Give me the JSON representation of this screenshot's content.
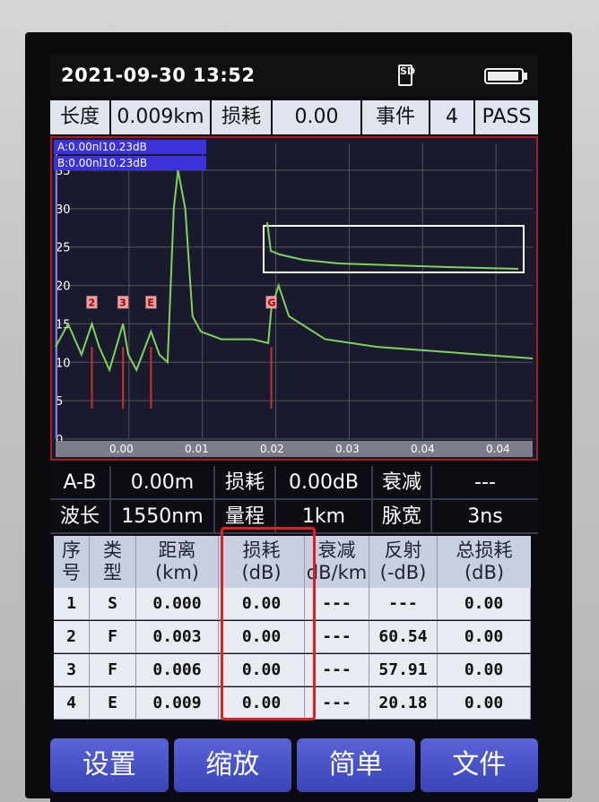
{
  "status": {
    "datetime": "2021-09-30  13:52",
    "sd_icon": "sd-card-icon",
    "battery_icon": "battery-icon",
    "battery_level": 0.95
  },
  "summary": {
    "length_label": "长度",
    "length_value": "0.009km",
    "loss_label": "损耗",
    "loss_value": "0.00",
    "event_label": "事件",
    "event_value": "4",
    "result": "PASS"
  },
  "cursors": {
    "a": "A:0.00nl10.23dB",
    "b": "B:0.00nl10.23dB"
  },
  "chart_data": {
    "type": "line",
    "title": "",
    "xlabel": "",
    "ylabel": "",
    "x_ticks": [
      "0.00",
      "0.01",
      "0.02",
      "0.03",
      "0.04",
      "0.04"
    ],
    "y_ticks": [
      "35",
      "30",
      "25",
      "20",
      "15",
      "10",
      "5",
      "0"
    ],
    "ylim": [
      0,
      35
    ],
    "xlim": [
      -0.001,
      0.045
    ],
    "series_color": "#7fd35a",
    "series": [
      {
        "name": "",
        "x": [
          -0.001,
          0.0002,
          0.0015,
          0.0025,
          0.0032,
          0.0042,
          0.0055,
          0.006,
          0.0068,
          0.0082,
          0.009,
          0.0098,
          0.0104,
          0.0108,
          0.0115,
          0.0122,
          0.013,
          0.015,
          0.018,
          0.0195,
          0.0198,
          0.0205,
          0.0215,
          0.025,
          0.03,
          0.035,
          0.04,
          0.045
        ],
        "y": [
          12,
          15,
          11,
          15,
          12,
          9,
          15,
          11,
          9,
          14,
          11,
          10,
          30,
          35,
          30,
          16,
          14,
          13,
          13,
          12.5,
          17,
          20,
          16,
          13,
          12,
          11.5,
          11,
          10.5
        ]
      }
    ],
    "events": [
      {
        "label": "2",
        "x": 0.0025
      },
      {
        "label": "3",
        "x": 0.0055
      },
      {
        "label": "E",
        "x": 0.0082
      },
      {
        "label": "G",
        "x": 0.0198
      }
    ]
  },
  "ab": {
    "label": "A-B",
    "value": "0.00m",
    "loss_label": "损耗",
    "loss_value": "0.00dB",
    "atten_label": "衰减",
    "atten_value": "---"
  },
  "params": {
    "wave_label": "波长",
    "wave_value": "1550nm",
    "range_label": "量程",
    "range_value": "1km",
    "pulse_label": "脉宽",
    "pulse_value": "3ns"
  },
  "table": {
    "headers": [
      "序\n号",
      "类\n型",
      "距离\n(km)",
      "损耗\n(dB)",
      "衰减\ndB/km",
      "反射\n(-dB)",
      "总损耗\n(dB)"
    ],
    "rows": [
      [
        "1",
        "S",
        "0.000",
        "0.00",
        "---",
        "---",
        "0.00"
      ],
      [
        "2",
        "F",
        "0.003",
        "0.00",
        "---",
        "60.54",
        "0.00"
      ],
      [
        "3",
        "F",
        "0.006",
        "0.00",
        "---",
        "57.91",
        "0.00"
      ],
      [
        "4",
        "E",
        "0.009",
        "0.00",
        "---",
        "20.18",
        "0.00"
      ]
    ]
  },
  "softkeys": [
    "设置",
    "缩放",
    "简单",
    "文件"
  ]
}
